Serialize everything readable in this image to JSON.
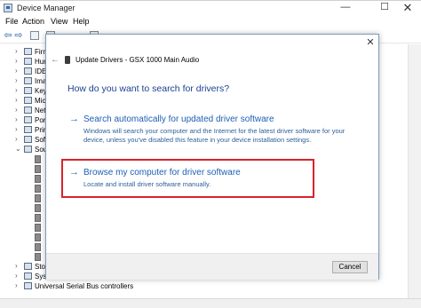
{
  "window": {
    "title": "Device Manager",
    "controls": {
      "minimize": "—",
      "maximize": "☐",
      "close": "✕"
    }
  },
  "menu": [
    "File",
    "Action",
    "View",
    "Help"
  ],
  "toolbar": {
    "back": "⇦",
    "forward": "⇨"
  },
  "tree": {
    "items": [
      "Firm",
      "Hum",
      "IDE",
      "Imag",
      "Keyl",
      "Mic",
      "Net",
      "Por",
      "Prin",
      "Soft",
      "Sou",
      "Sto",
      "Sys"
    ],
    "last": "Universal Serial Bus controllers"
  },
  "dialog": {
    "title": "Update Drivers - GSX 1000 Main Audio",
    "back_arrow": "←",
    "close": "✕",
    "heading": "How do you want to search for drivers?",
    "options": [
      {
        "arrow": "→",
        "title": "Search automatically for updated driver software",
        "description": "Windows will search your computer and the Internet for the latest driver software for your device, unless you've disabled this feature in your device installation settings."
      },
      {
        "arrow": "→",
        "title": "Browse my computer for driver software",
        "description": "Locate and install driver software manually."
      }
    ],
    "cancel": "Cancel"
  },
  "colors": {
    "accent": "#1c5fb5",
    "heading": "#1c3f94",
    "highlight_box": "#d7242a"
  }
}
